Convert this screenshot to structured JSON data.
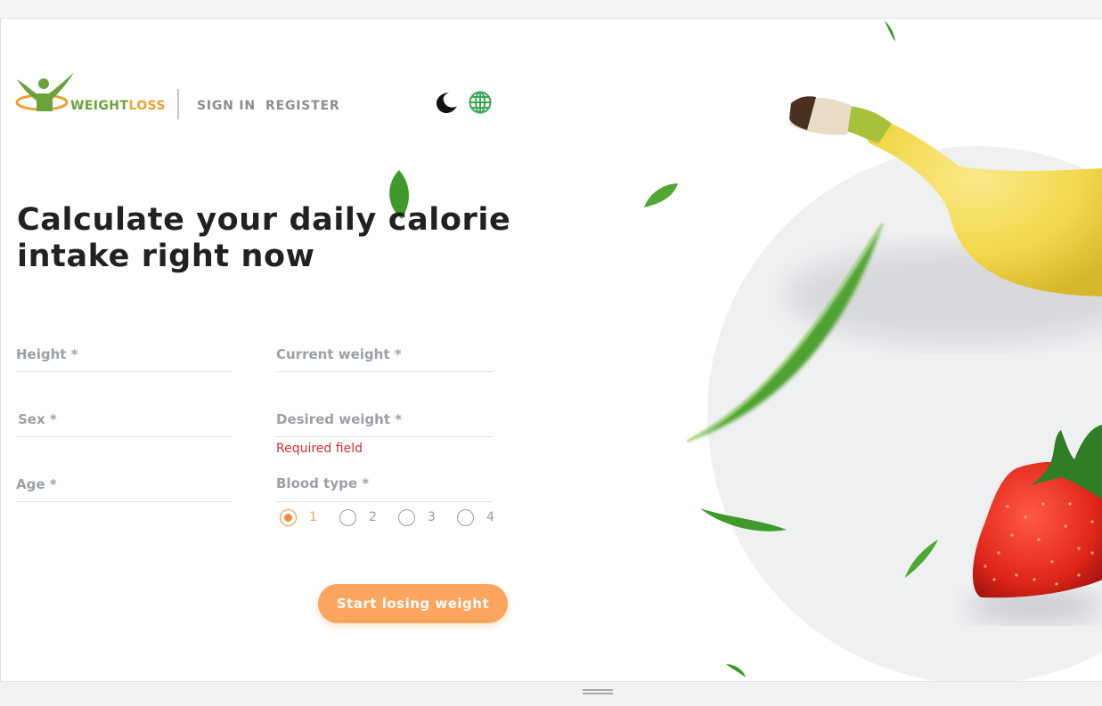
{
  "brand": {
    "name_part1": "WEIGHT",
    "name_part2": "LOSS",
    "colors": {
      "green": "#6aa33a",
      "orange": "#f0a030",
      "accent": "#fca55f",
      "error": "#d23131"
    }
  },
  "nav": {
    "sign_in": "SIGN IN",
    "register": "REGISTER"
  },
  "header_icons": {
    "theme": "moon-icon",
    "language": "globe-icon"
  },
  "title": {
    "line1": "Calculate your daily calorie",
    "line2": "intake right now"
  },
  "form": {
    "height_label": "Height *",
    "current_weight_label": "Current weight *",
    "sex_label": "Sex *",
    "desired_weight_label": "Desired weight *",
    "desired_weight_error": "Required field",
    "age_label": "Age  *",
    "blood_type_label": "Blood type *",
    "blood_type_options": [
      "1",
      "2",
      "3",
      "4"
    ],
    "blood_type_selected": "1",
    "submit_label": "Start losing weight"
  }
}
